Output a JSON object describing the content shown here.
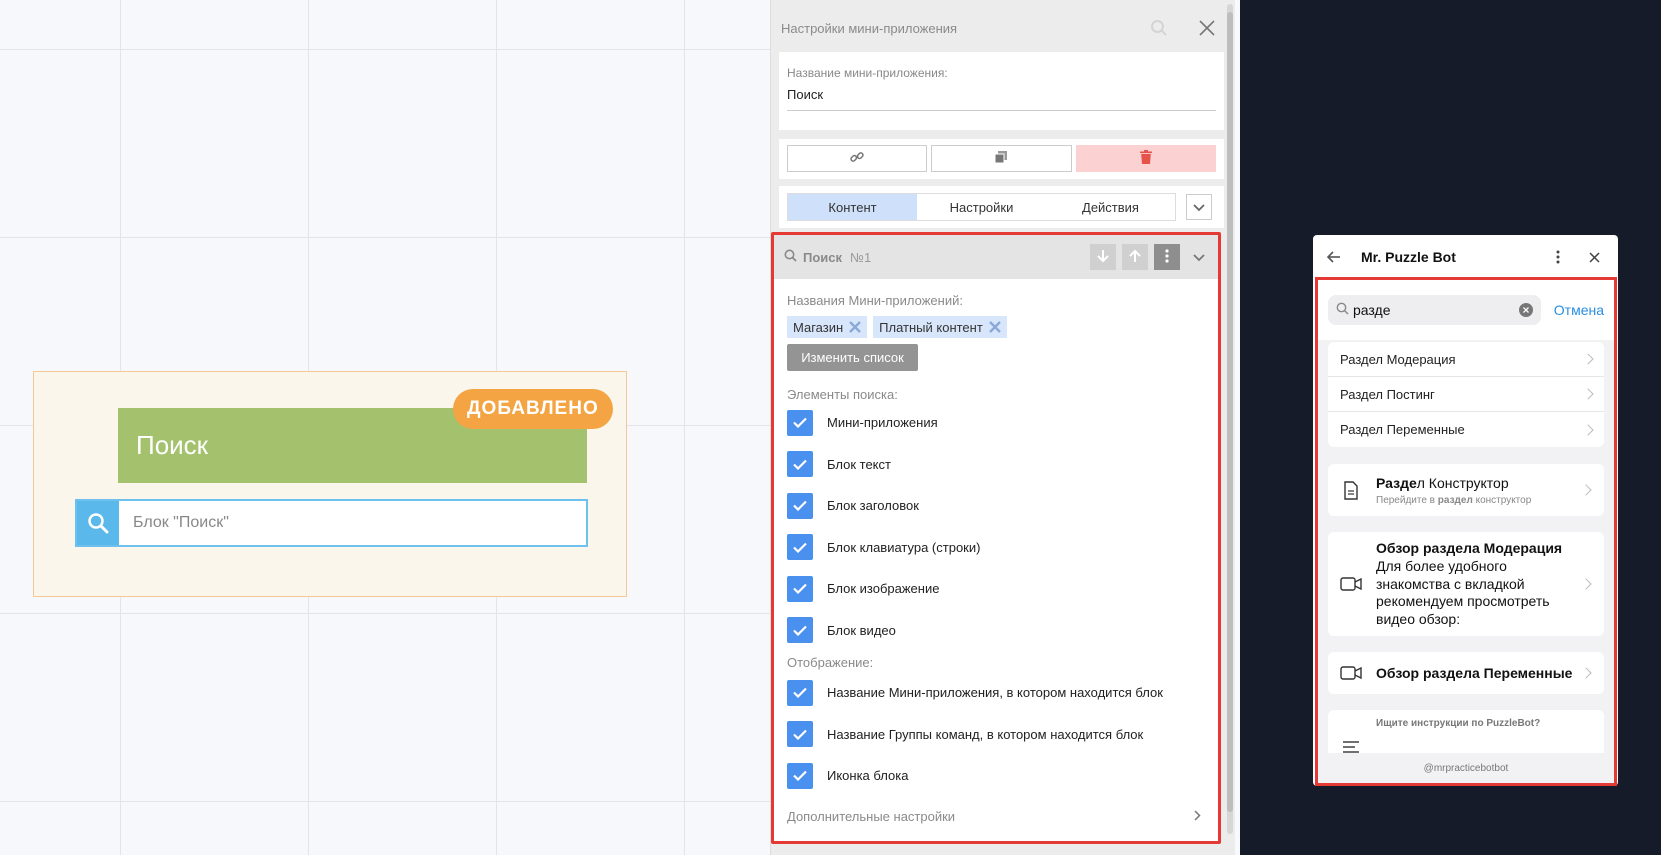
{
  "canvas": {
    "node": {
      "title": "Поиск",
      "badge": "ДОБАВЛЕНО",
      "search_placeholder": "Блок \"Поиск\""
    }
  },
  "panel": {
    "header": "Настройки мини-приложения",
    "name_label": "Название мини-приложения:",
    "name_value": "Поиск",
    "tabs": [
      "Контент",
      "Настройки",
      "Действия"
    ],
    "block": {
      "title": "Поиск",
      "number": "№1",
      "apps_label": "Названия Мини-приложений:",
      "chips": [
        "Магазин",
        "Платный контент"
      ],
      "change_button": "Изменить список",
      "elements_label": "Элементы поиска:",
      "elements": [
        "Мини-приложения",
        "Блок текст",
        "Блок заголовок",
        "Блок клавиатура (строки)",
        "Блок изображение",
        "Блок видео"
      ],
      "display_label": "Отображение:",
      "display": [
        "Название Мини-приложения, в котором находится блок",
        "Название Группы команд, в котором находится блок",
        "Иконка блока"
      ],
      "advanced": "Дополнительные настройки"
    }
  },
  "phone": {
    "title": "Mr. Puzzle Bot",
    "query": "разде",
    "cancel": "Отмена",
    "list": [
      "Раздел Модерация",
      "Раздел Постинг",
      "Раздел Переменные"
    ],
    "doc_card": {
      "title_bold": "Разде",
      "title_rest": "л Конструктор",
      "sub_pre": "Перейдите в ",
      "sub_bold": "раздел",
      "sub_post": " конструктор"
    },
    "video_card_1": {
      "title": "Обзор раздела Модерация",
      "body": "Для более удобного знакомства с вкладкой рекомендуем просмотреть видео обзор:"
    },
    "video_card_2": {
      "title": "Обзор раздела Переменные"
    },
    "instr_card": {
      "title": "Ищите инструкции по PuzzleBot?"
    },
    "footer": "@mrpracticebotbot"
  }
}
